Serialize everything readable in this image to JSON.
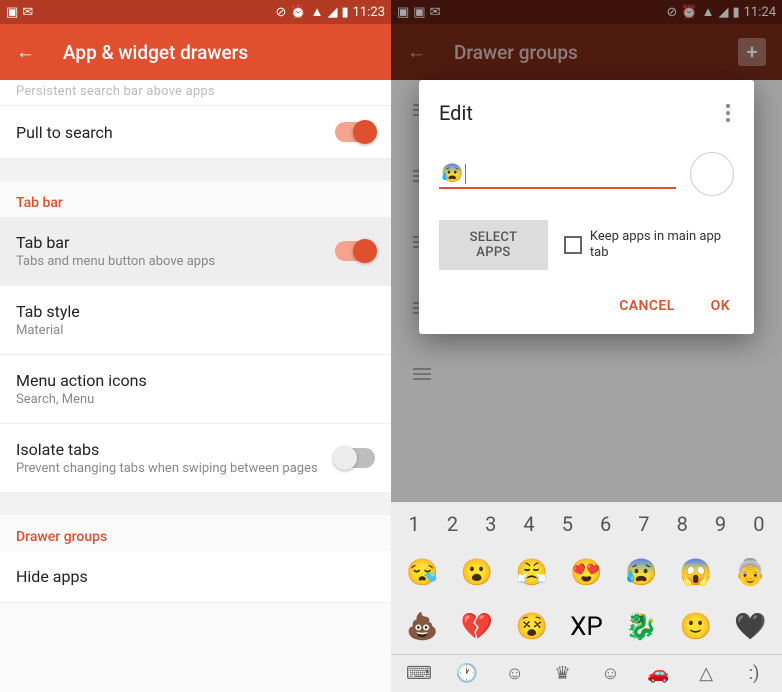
{
  "left": {
    "statusbar": {
      "time": "11:23"
    },
    "appbar": {
      "title": "App & widget drawers"
    },
    "cutoff_text": "Persistent search bar above apps",
    "rows": {
      "pull_to_search": {
        "title": "Pull to search"
      },
      "tabbar_header": "Tab bar",
      "tab_bar": {
        "title": "Tab bar",
        "sub": "Tabs and menu button above apps"
      },
      "tab_style": {
        "title": "Tab style",
        "sub": "Material"
      },
      "menu_icons": {
        "title": "Menu action icons",
        "sub": "Search, Menu"
      },
      "isolate": {
        "title": "Isolate tabs",
        "sub": "Prevent changing tabs when swiping between pages"
      },
      "drawer_groups_header": "Drawer groups",
      "hide_apps": {
        "title": "Hide apps"
      }
    }
  },
  "right": {
    "statusbar": {
      "time": "11:24"
    },
    "appbar": {
      "title": "Drawer groups"
    },
    "dialog": {
      "title": "Edit",
      "input_emoji": "😰",
      "select_apps": "SELECT APPS",
      "keep_label": "Keep apps in main app tab",
      "cancel": "CANCEL",
      "ok": "OK"
    },
    "keyboard": {
      "numbers": [
        "1",
        "2",
        "3",
        "4",
        "5",
        "6",
        "7",
        "8",
        "9",
        "0"
      ],
      "row1": [
        "😪",
        "😮",
        "😤",
        "😍",
        "😰",
        "😱",
        "👵"
      ],
      "row2": [
        "💩",
        "💔",
        "😵",
        "XP",
        "🐉",
        "🙂",
        "🖤"
      ],
      "bottom": [
        "⌨",
        "🕐",
        "☺",
        "♛",
        "☺",
        "🚗",
        "△",
        ":)"
      ]
    }
  }
}
